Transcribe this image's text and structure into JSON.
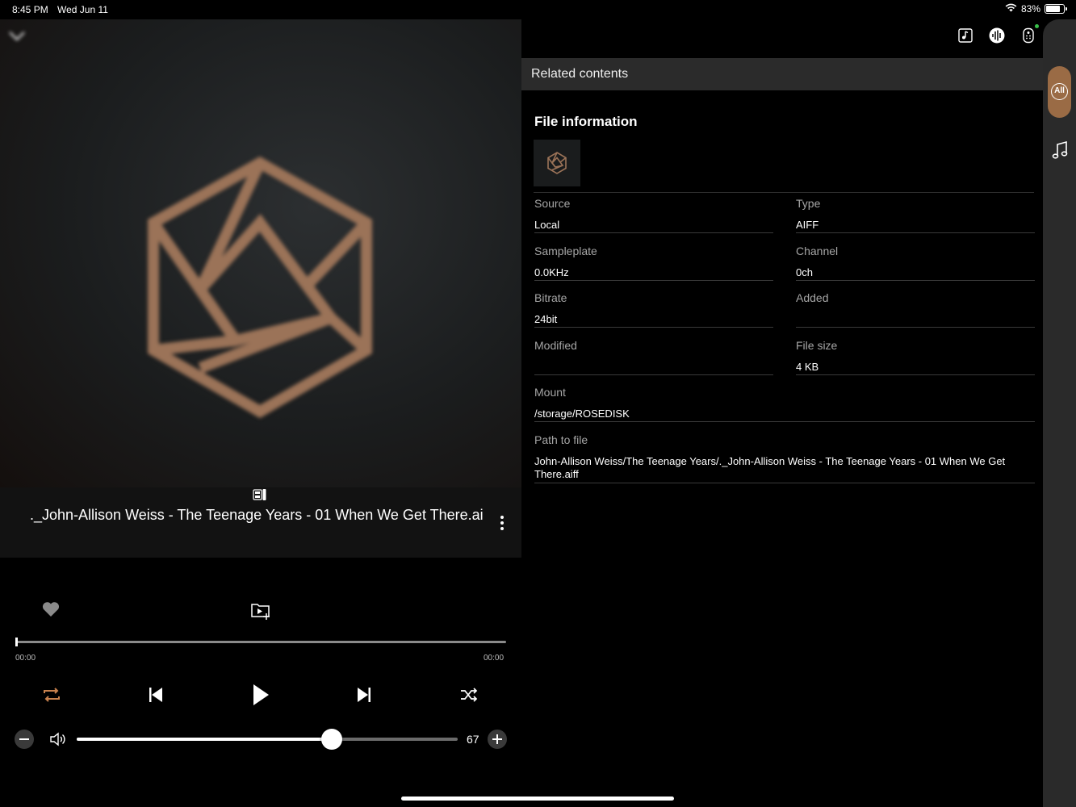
{
  "status_bar": {
    "time": "8:45 PM",
    "date": "Wed Jun 11",
    "battery_text": "83%",
    "battery_level": 0.83
  },
  "player": {
    "track_title": "._John-Allison Weiss - The Teenage Years - 01 When We Get There.ai",
    "time_elapsed": "00:00",
    "time_total": "00:00",
    "progress": 0.0,
    "volume": 67,
    "volume_level": 0.67,
    "accent_color": "#c8824e",
    "art_accent_color": "#9b7358",
    "icons": [
      "chevron-down-icon",
      "format-badge-icon",
      "more-vertical-icon",
      "heart-icon",
      "add-to-queue-icon",
      "repeat-icon",
      "previous-icon",
      "play-icon",
      "next-icon",
      "shuffle-icon",
      "minus-icon",
      "speaker-icon",
      "plus-icon"
    ]
  },
  "right_panel": {
    "section_title": "Related contents",
    "file_info_title": "File information",
    "fields": {
      "source": {
        "label": "Source",
        "value": "Local"
      },
      "type": {
        "label": "Type",
        "value": "AIFF"
      },
      "samplerate": {
        "label": "Sampleplate",
        "value": "0.0KHz"
      },
      "channel": {
        "label": "Channel",
        "value": "0ch"
      },
      "bitrate": {
        "label": "Bitrate",
        "value": "24bit"
      },
      "added": {
        "label": "Added",
        "value": ""
      },
      "modified": {
        "label": "Modified",
        "value": ""
      },
      "file_size": {
        "label": "File size",
        "value": "4 KB"
      },
      "mount": {
        "label": "Mount",
        "value": "/storage/ROSEDISK"
      },
      "path": {
        "label": "Path to file",
        "value": "John-Allison Weiss/The Teenage Years/._John-Allison Weiss - The Teenage Years - 01 When We Get There.aiff"
      }
    },
    "top_icons": [
      "lyrics-icon",
      "audio-quality-icon",
      "remote-icon"
    ]
  },
  "side_rail": {
    "all_label": "All",
    "all_color": "#9a6b45",
    "icons": [
      "all-filter-icon",
      "music-note-icon"
    ]
  }
}
